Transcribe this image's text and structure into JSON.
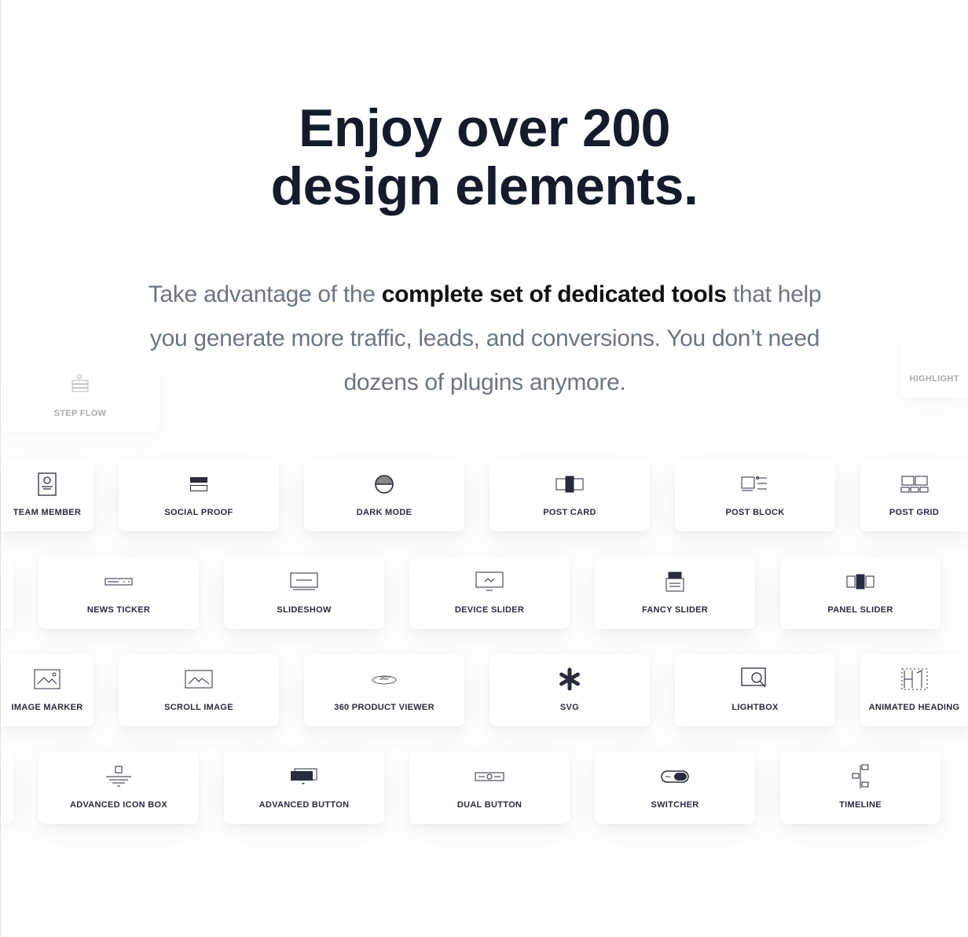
{
  "heading": {
    "line1": "Enjoy over 200",
    "line2": "design elements."
  },
  "lead": {
    "before": "Take advantage of the ",
    "bold": "complete set of dedicated tools",
    "after": " that help you generate more traffic, leads, and conversions. You don’t need dozens of plugins anymore."
  },
  "colors": {
    "heading": "#151b2b",
    "body": "#6b7683",
    "icon": "#2a2b3d"
  },
  "floating": [
    {
      "label": "STEP FLOW",
      "icon": "step-flow-icon"
    },
    {
      "label": "HIGHLIGHT",
      "icon": "highlight-icon"
    }
  ],
  "rows": [
    [
      {
        "label": "TEAM MEMBER",
        "icon": "team-member-icon"
      },
      {
        "label": "SOCIAL PROOF",
        "icon": "social-proof-icon"
      },
      {
        "label": "DARK MODE",
        "icon": "dark-mode-icon"
      },
      {
        "label": "POST CARD",
        "icon": "post-card-icon"
      },
      {
        "label": "POST BLOCK",
        "icon": "post-block-icon"
      },
      {
        "label": "POST GRID",
        "icon": "post-grid-icon"
      }
    ],
    [
      {
        "label": "NEWS TICKER",
        "icon": "news-ticker-icon"
      },
      {
        "label": "SLIDESHOW",
        "icon": "slideshow-icon"
      },
      {
        "label": "DEVICE SLIDER",
        "icon": "device-slider-icon"
      },
      {
        "label": "FANCY SLIDER",
        "icon": "fancy-slider-icon"
      },
      {
        "label": "PANEL SLIDER",
        "icon": "panel-slider-icon"
      }
    ],
    [
      {
        "label": "IMAGE MARKER",
        "icon": "image-marker-icon"
      },
      {
        "label": "SCROLL IMAGE",
        "icon": "scroll-image-icon"
      },
      {
        "label": "360 PRODUCT VIEWER",
        "icon": "360-viewer-icon"
      },
      {
        "label": "SVG",
        "icon": "svg-asterisk-icon"
      },
      {
        "label": "LIGHTBOX",
        "icon": "lightbox-icon"
      },
      {
        "label": "ANIMATED HEADING",
        "icon": "animated-heading-icon"
      }
    ],
    [
      {
        "label": "ADVANCED ICON BOX",
        "icon": "advanced-icon-box-icon"
      },
      {
        "label": "ADVANCED BUTTON",
        "icon": "advanced-button-icon"
      },
      {
        "label": "DUAL BUTTON",
        "icon": "dual-button-icon"
      },
      {
        "label": "SWITCHER",
        "icon": "switcher-icon"
      },
      {
        "label": "TIMELINE",
        "icon": "timeline-icon"
      }
    ]
  ]
}
